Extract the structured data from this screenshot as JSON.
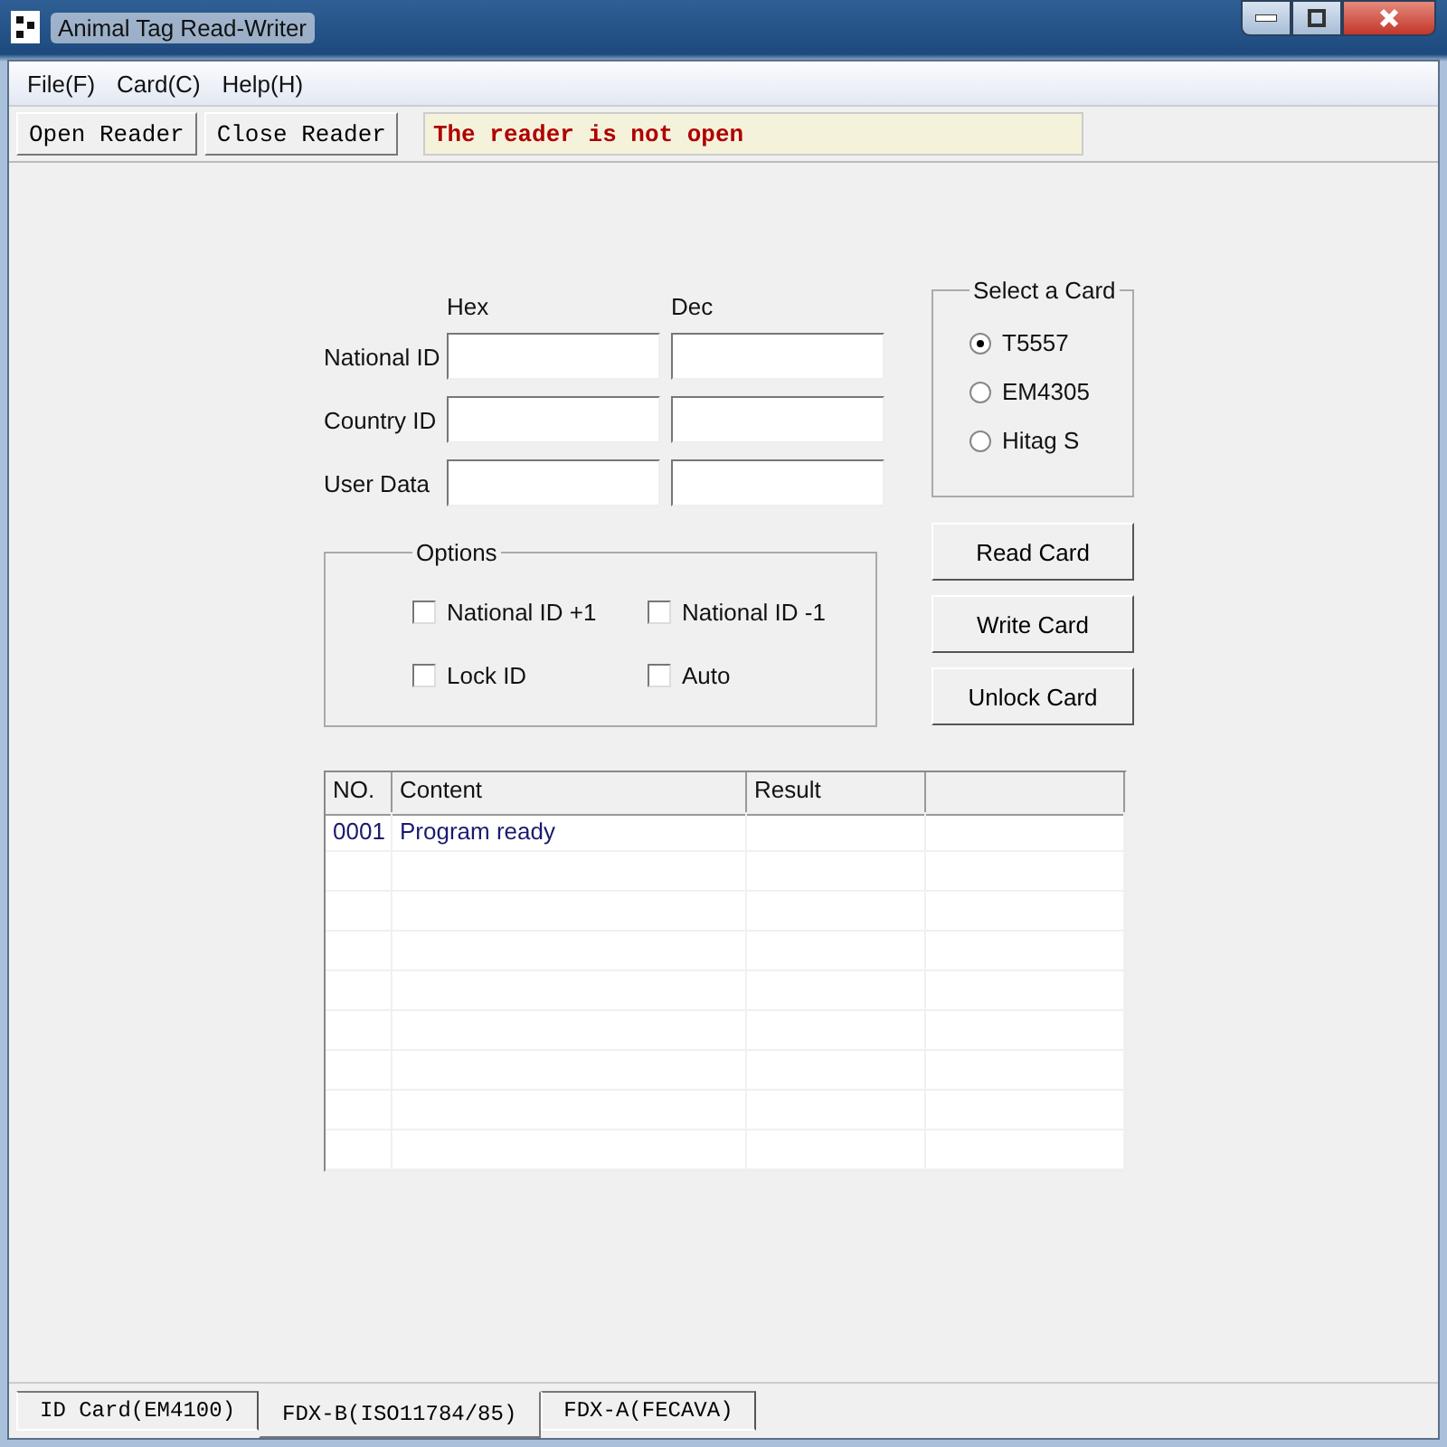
{
  "window": {
    "title": "Animal Tag Read-Writer"
  },
  "menu": [
    "File(F)",
    "Card(C)",
    "Help(H)"
  ],
  "toolbar": {
    "buttons": [
      "Open Reader",
      "Close Reader"
    ],
    "status": "The reader is not open"
  },
  "id_fields": {
    "columns": [
      "Hex",
      "Dec"
    ],
    "rows": [
      {
        "label": "National ID"
      },
      {
        "label": "Country ID"
      },
      {
        "label": "User Data"
      }
    ]
  },
  "card_select": {
    "title": "Select a Card",
    "options": [
      {
        "label": "T5557",
        "selected": true
      },
      {
        "label": "EM4305",
        "selected": false
      },
      {
        "label": "Hitag S",
        "selected": false
      }
    ]
  },
  "options": {
    "title": "Options",
    "items": [
      {
        "label": "National ID +1",
        "checked": false
      },
      {
        "label": "National ID -1",
        "checked": false
      },
      {
        "label": "Lock ID",
        "checked": false
      },
      {
        "label": "Auto",
        "checked": false
      }
    ]
  },
  "actions": [
    "Read Card",
    "Write Card",
    "Unlock Card"
  ],
  "log": {
    "columns": [
      "NO.",
      "Content",
      "Result"
    ],
    "rows": [
      {
        "no": "0001",
        "content": "Program ready"
      }
    ]
  },
  "tabs": [
    {
      "label": "ID Card(EM4100)",
      "selected": false
    },
    {
      "label": "FDX-B(ISO11784/85)",
      "selected": true
    },
    {
      "label": "FDX-A(FECAVA)",
      "selected": false
    }
  ]
}
